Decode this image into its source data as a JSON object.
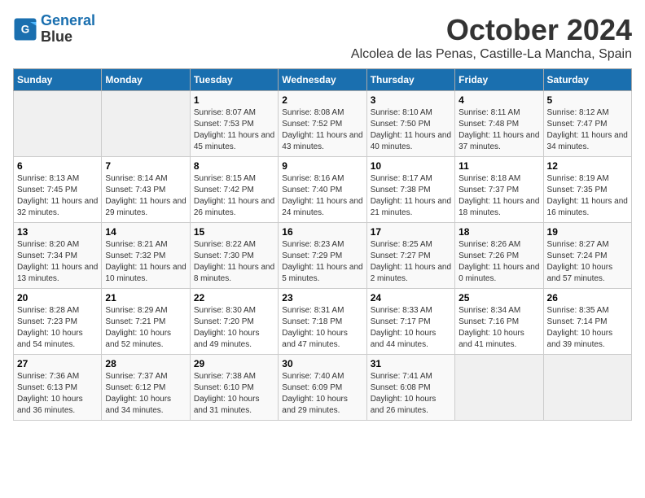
{
  "header": {
    "logo_line1": "General",
    "logo_line2": "Blue",
    "title": "October 2024",
    "subtitle": "Alcolea de las Penas, Castille-La Mancha, Spain"
  },
  "days_of_week": [
    "Sunday",
    "Monday",
    "Tuesday",
    "Wednesday",
    "Thursday",
    "Friday",
    "Saturday"
  ],
  "weeks": [
    [
      {
        "day": "",
        "info": ""
      },
      {
        "day": "",
        "info": ""
      },
      {
        "day": "1",
        "info": "Sunrise: 8:07 AM\nSunset: 7:53 PM\nDaylight: 11 hours and 45 minutes."
      },
      {
        "day": "2",
        "info": "Sunrise: 8:08 AM\nSunset: 7:52 PM\nDaylight: 11 hours and 43 minutes."
      },
      {
        "day": "3",
        "info": "Sunrise: 8:10 AM\nSunset: 7:50 PM\nDaylight: 11 hours and 40 minutes."
      },
      {
        "day": "4",
        "info": "Sunrise: 8:11 AM\nSunset: 7:48 PM\nDaylight: 11 hours and 37 minutes."
      },
      {
        "day": "5",
        "info": "Sunrise: 8:12 AM\nSunset: 7:47 PM\nDaylight: 11 hours and 34 minutes."
      }
    ],
    [
      {
        "day": "6",
        "info": "Sunrise: 8:13 AM\nSunset: 7:45 PM\nDaylight: 11 hours and 32 minutes."
      },
      {
        "day": "7",
        "info": "Sunrise: 8:14 AM\nSunset: 7:43 PM\nDaylight: 11 hours and 29 minutes."
      },
      {
        "day": "8",
        "info": "Sunrise: 8:15 AM\nSunset: 7:42 PM\nDaylight: 11 hours and 26 minutes."
      },
      {
        "day": "9",
        "info": "Sunrise: 8:16 AM\nSunset: 7:40 PM\nDaylight: 11 hours and 24 minutes."
      },
      {
        "day": "10",
        "info": "Sunrise: 8:17 AM\nSunset: 7:38 PM\nDaylight: 11 hours and 21 minutes."
      },
      {
        "day": "11",
        "info": "Sunrise: 8:18 AM\nSunset: 7:37 PM\nDaylight: 11 hours and 18 minutes."
      },
      {
        "day": "12",
        "info": "Sunrise: 8:19 AM\nSunset: 7:35 PM\nDaylight: 11 hours and 16 minutes."
      }
    ],
    [
      {
        "day": "13",
        "info": "Sunrise: 8:20 AM\nSunset: 7:34 PM\nDaylight: 11 hours and 13 minutes."
      },
      {
        "day": "14",
        "info": "Sunrise: 8:21 AM\nSunset: 7:32 PM\nDaylight: 11 hours and 10 minutes."
      },
      {
        "day": "15",
        "info": "Sunrise: 8:22 AM\nSunset: 7:30 PM\nDaylight: 11 hours and 8 minutes."
      },
      {
        "day": "16",
        "info": "Sunrise: 8:23 AM\nSunset: 7:29 PM\nDaylight: 11 hours and 5 minutes."
      },
      {
        "day": "17",
        "info": "Sunrise: 8:25 AM\nSunset: 7:27 PM\nDaylight: 11 hours and 2 minutes."
      },
      {
        "day": "18",
        "info": "Sunrise: 8:26 AM\nSunset: 7:26 PM\nDaylight: 11 hours and 0 minutes."
      },
      {
        "day": "19",
        "info": "Sunrise: 8:27 AM\nSunset: 7:24 PM\nDaylight: 10 hours and 57 minutes."
      }
    ],
    [
      {
        "day": "20",
        "info": "Sunrise: 8:28 AM\nSunset: 7:23 PM\nDaylight: 10 hours and 54 minutes."
      },
      {
        "day": "21",
        "info": "Sunrise: 8:29 AM\nSunset: 7:21 PM\nDaylight: 10 hours and 52 minutes."
      },
      {
        "day": "22",
        "info": "Sunrise: 8:30 AM\nSunset: 7:20 PM\nDaylight: 10 hours and 49 minutes."
      },
      {
        "day": "23",
        "info": "Sunrise: 8:31 AM\nSunset: 7:18 PM\nDaylight: 10 hours and 47 minutes."
      },
      {
        "day": "24",
        "info": "Sunrise: 8:33 AM\nSunset: 7:17 PM\nDaylight: 10 hours and 44 minutes."
      },
      {
        "day": "25",
        "info": "Sunrise: 8:34 AM\nSunset: 7:16 PM\nDaylight: 10 hours and 41 minutes."
      },
      {
        "day": "26",
        "info": "Sunrise: 8:35 AM\nSunset: 7:14 PM\nDaylight: 10 hours and 39 minutes."
      }
    ],
    [
      {
        "day": "27",
        "info": "Sunrise: 7:36 AM\nSunset: 6:13 PM\nDaylight: 10 hours and 36 minutes."
      },
      {
        "day": "28",
        "info": "Sunrise: 7:37 AM\nSunset: 6:12 PM\nDaylight: 10 hours and 34 minutes."
      },
      {
        "day": "29",
        "info": "Sunrise: 7:38 AM\nSunset: 6:10 PM\nDaylight: 10 hours and 31 minutes."
      },
      {
        "day": "30",
        "info": "Sunrise: 7:40 AM\nSunset: 6:09 PM\nDaylight: 10 hours and 29 minutes."
      },
      {
        "day": "31",
        "info": "Sunrise: 7:41 AM\nSunset: 6:08 PM\nDaylight: 10 hours and 26 minutes."
      },
      {
        "day": "",
        "info": ""
      },
      {
        "day": "",
        "info": ""
      }
    ]
  ]
}
